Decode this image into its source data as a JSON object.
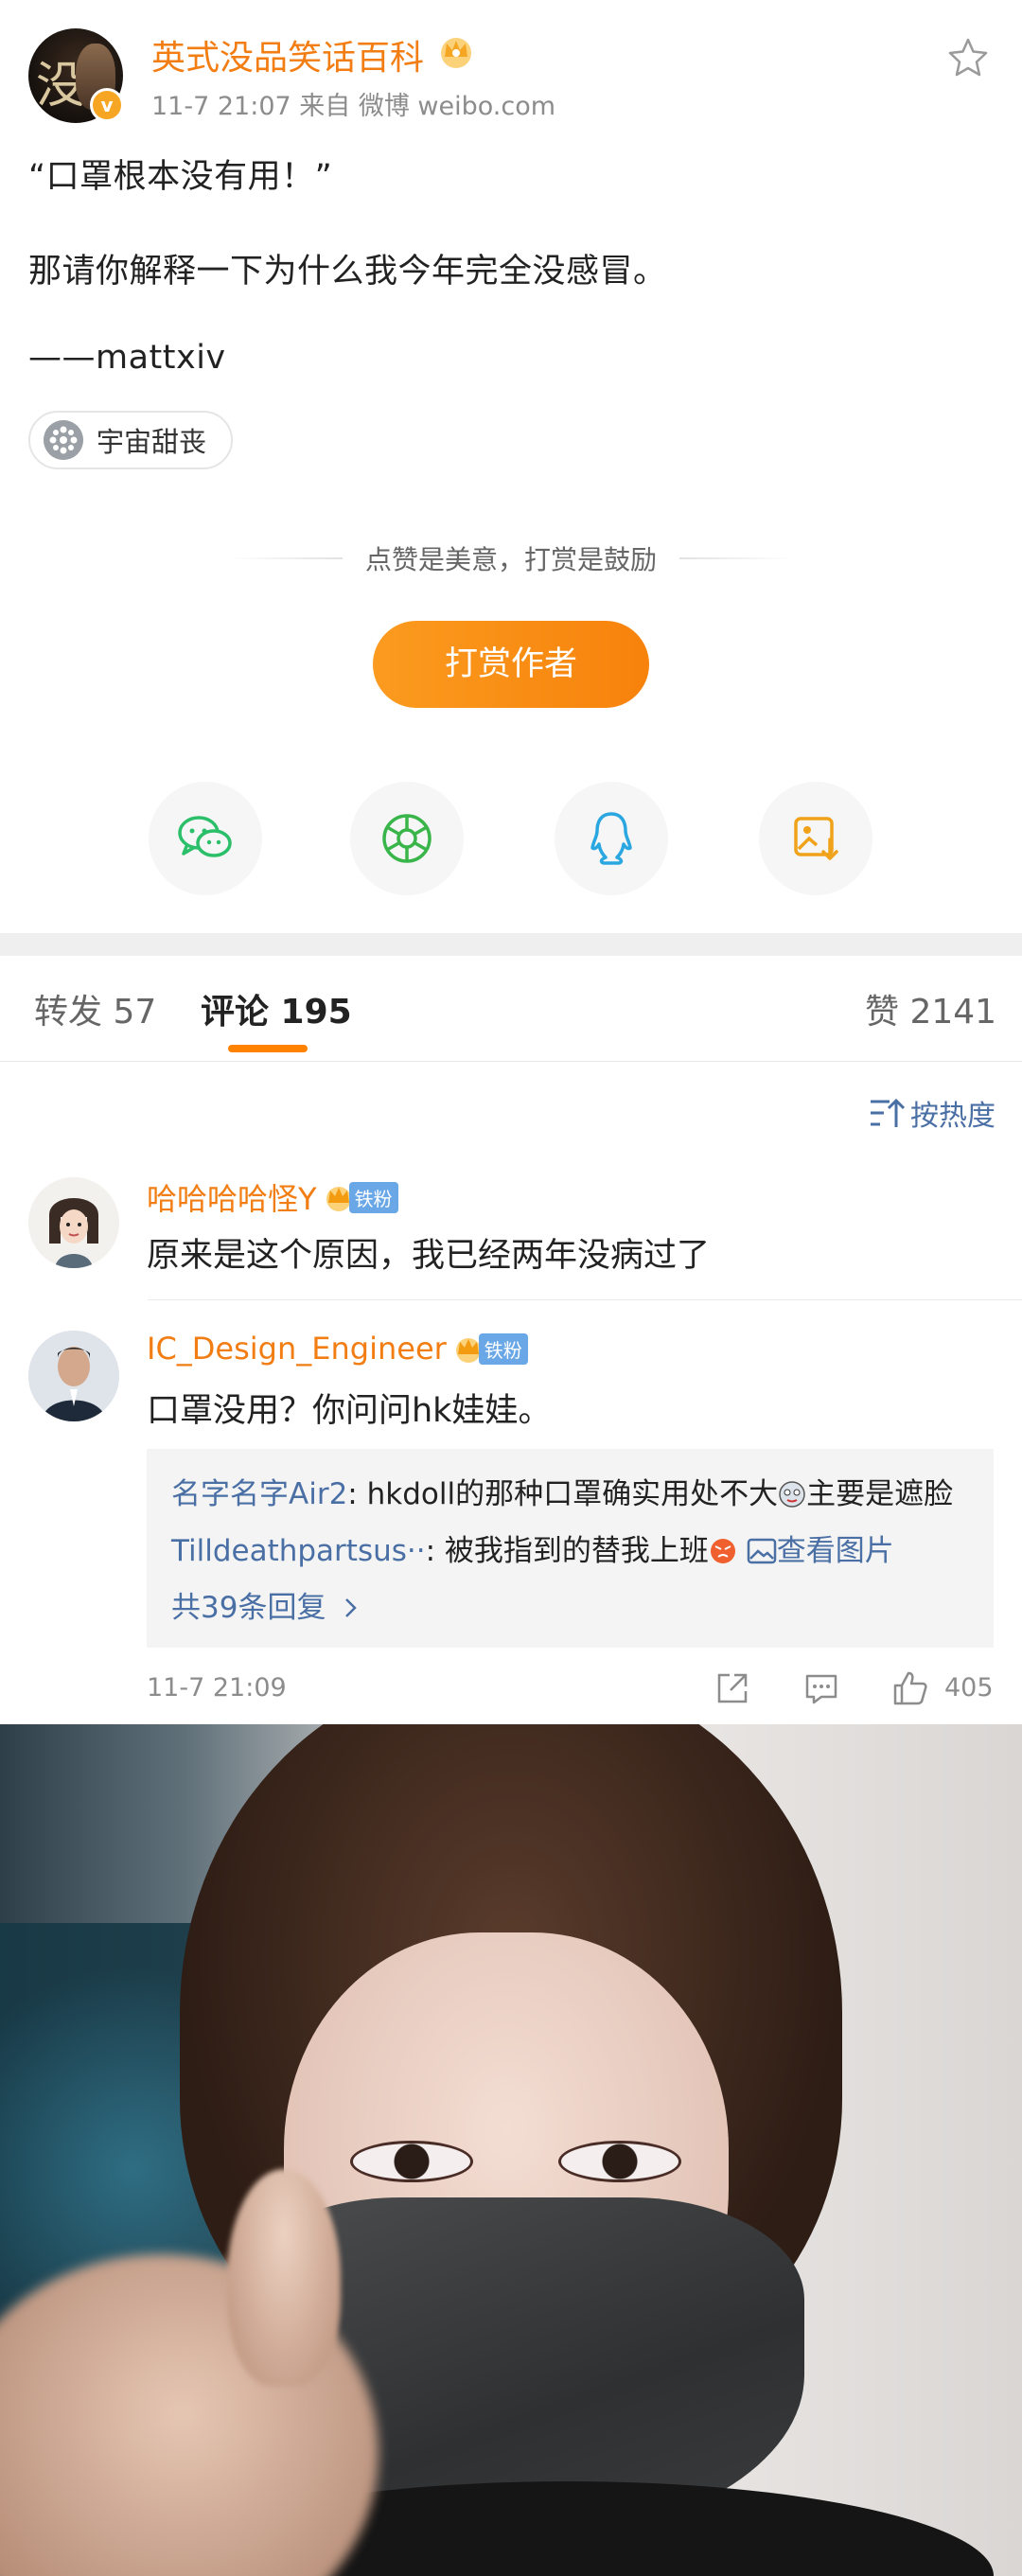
{
  "post": {
    "author": "英式没品笑话百科",
    "avatar_glyph": "没",
    "verified_badge": "v",
    "meta": "11-7 21:07  来自 微博 weibo.com",
    "lines": [
      "“口罩根本没有用！”",
      "那请你解释一下为什么我今年完全没感冒。",
      "——mattxiv"
    ],
    "topic": "宇宙甜丧"
  },
  "reward": {
    "prompt": "点赞是美意，打赏是鼓励",
    "button": "打赏作者"
  },
  "share": {
    "icons": [
      "wechat-icon",
      "moments-icon",
      "qq-icon",
      "save-image-icon"
    ]
  },
  "tabs": {
    "repost": "转发 57",
    "comments": "评论 195",
    "likes": "赞 2141"
  },
  "sort": {
    "label": "按热度"
  },
  "comments": [
    {
      "name": "哈哈哈哈怪Y",
      "fan_tag": "铁粉",
      "text": "原来是这个原因，我已经两年没病过了"
    },
    {
      "name": "IC_Design_Engineer",
      "fan_tag": "铁粉",
      "text": "口罩没用？你问问hk娃娃。",
      "replies": [
        {
          "user": "名字名字Air2",
          "text": ": hkdoll的那种口罩确实用处不大",
          "tail": "主要是遮脸"
        },
        {
          "user": "Tilldeathpartsus··",
          "text": ": 被我指到的替我上班",
          "link": "查看图片"
        }
      ],
      "more": "共39条回复",
      "time": "11-7 21:09",
      "likes": "405"
    }
  ],
  "colors": {
    "accent": "#f27d13",
    "link": "#4a6fa5",
    "reward": "#fb9b1f"
  }
}
